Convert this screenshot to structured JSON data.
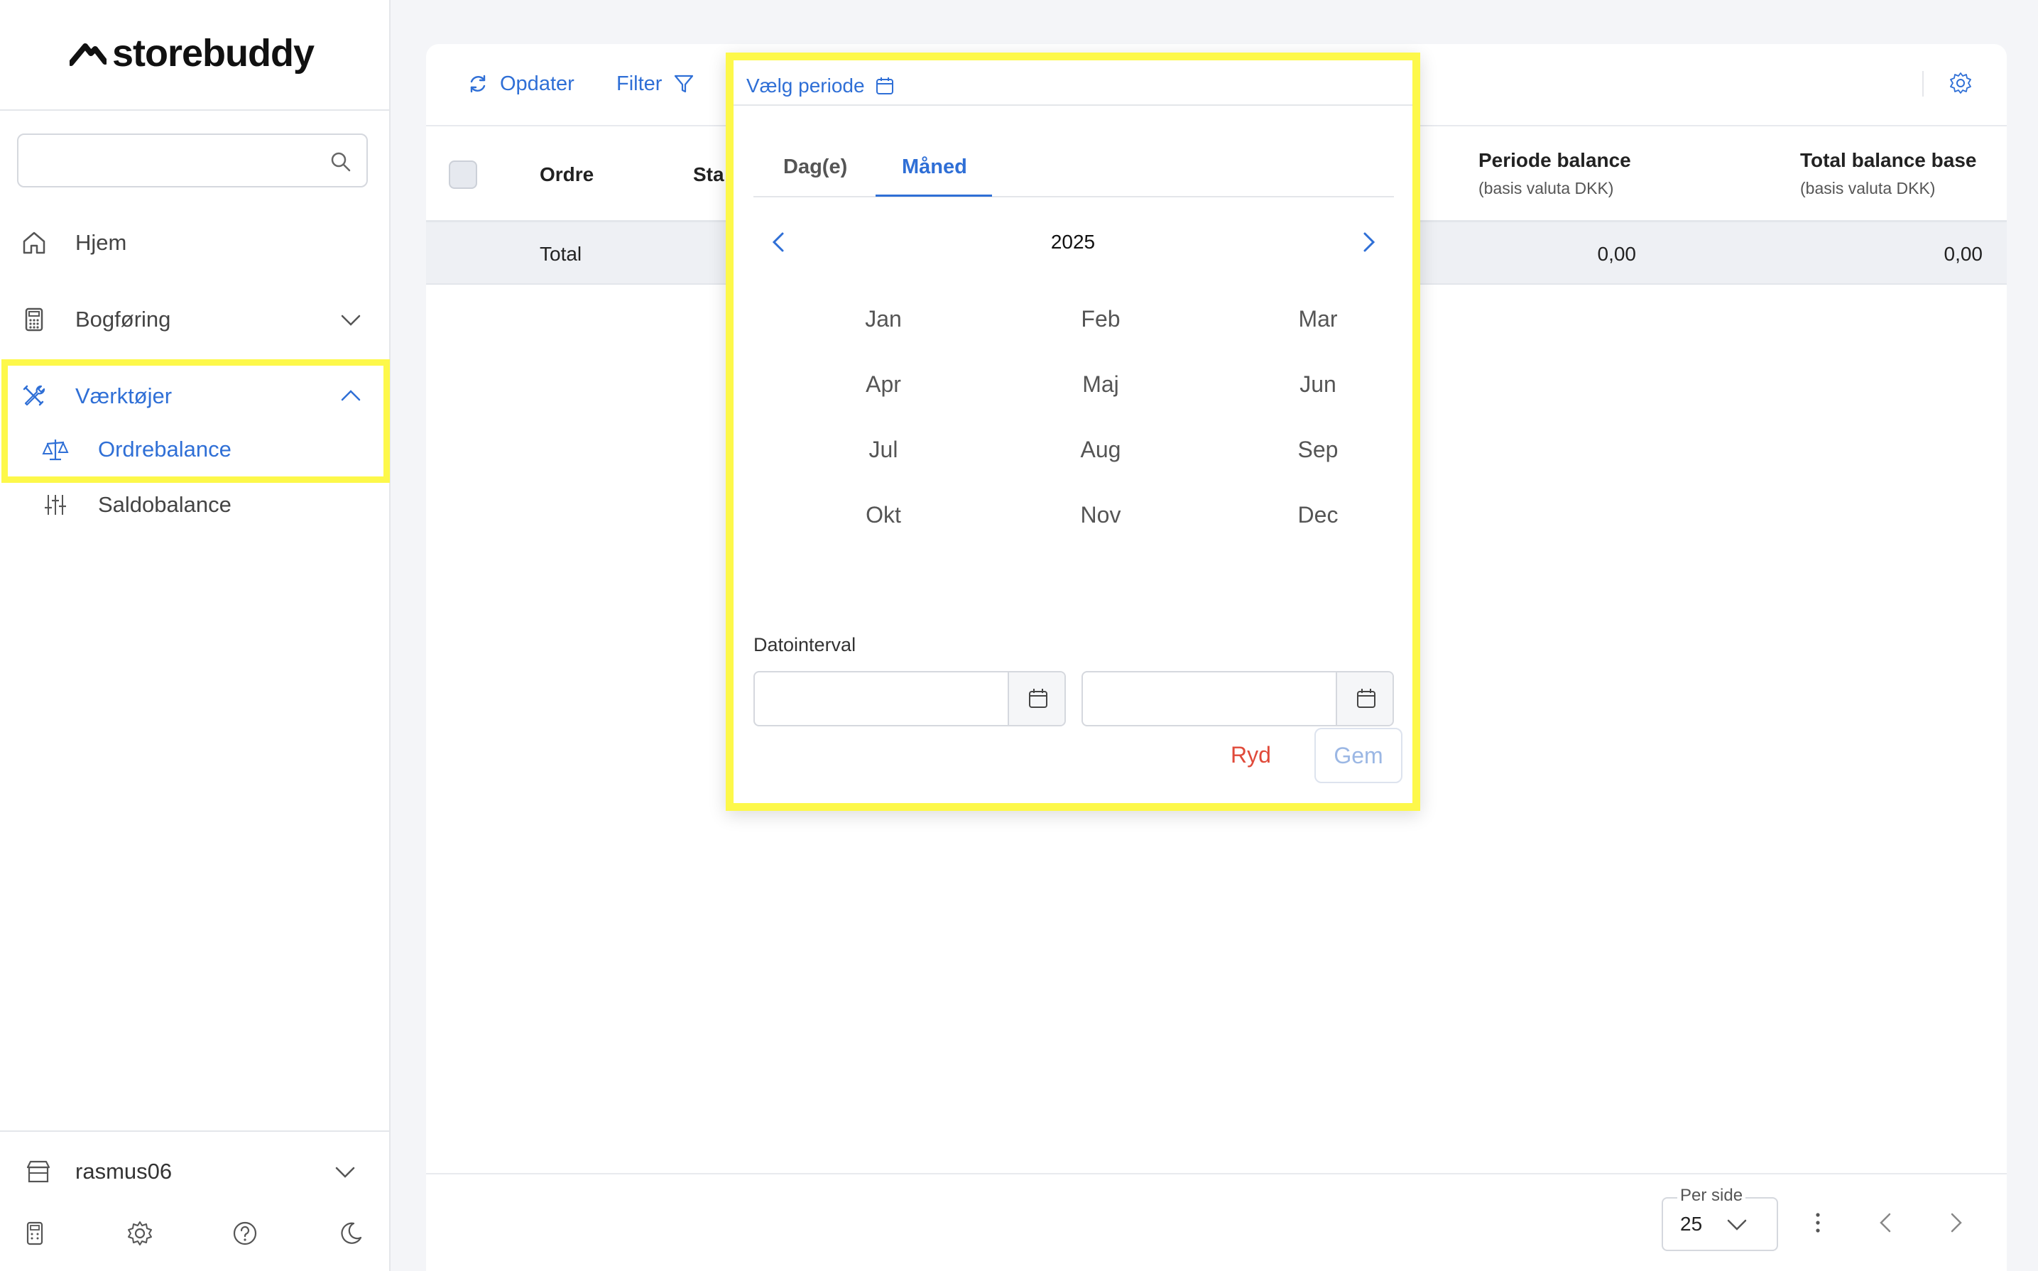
{
  "brand": {
    "name": "storebuddy"
  },
  "sidebar": {
    "search": {
      "placeholder": ""
    },
    "items": [
      {
        "label": "Hjem",
        "icon": "home-icon"
      },
      {
        "label": "Bogføring",
        "icon": "calculator-icon"
      },
      {
        "label": "Værktøjer",
        "icon": "tools-icon",
        "expanded": true
      },
      {
        "label": "Ordrebalance",
        "icon": "scale-icon",
        "active": true
      },
      {
        "label": "Saldobalance",
        "icon": "sliders-icon"
      }
    ],
    "user": {
      "name": "rasmus06"
    }
  },
  "toolbar": {
    "refresh_label": "Opdater",
    "filter_label": "Filter",
    "period_label": "Vælg periode"
  },
  "table": {
    "columns": {
      "order": "Ordre",
      "status": "Sta",
      "period_balance": "Periode balance",
      "period_balance_sub": "(basis valuta DKK)",
      "total_balance": "Total balance base",
      "total_balance_sub": "(basis valuta DKK)"
    },
    "total_row": {
      "label": "Total",
      "period_balance": "0,00",
      "total_balance": "0,00"
    }
  },
  "pagination": {
    "per_page_label": "Per side",
    "per_page_value": "25"
  },
  "period_picker": {
    "tabs": [
      {
        "label": "Dag(e)"
      },
      {
        "label": "Måned",
        "active": true
      }
    ],
    "year": "2025",
    "months": [
      "Jan",
      "Feb",
      "Mar",
      "Apr",
      "Maj",
      "Jun",
      "Jul",
      "Aug",
      "Sep",
      "Okt",
      "Nov",
      "Dec"
    ],
    "range_label": "Datointerval",
    "start": {
      "value": ""
    },
    "end": {
      "value": ""
    },
    "clear_label": "Ryd",
    "save_label": "Gem"
  },
  "colors": {
    "accent": "#2f6fd6",
    "danger": "#e04a3a",
    "highlight": "#fdf84a"
  }
}
